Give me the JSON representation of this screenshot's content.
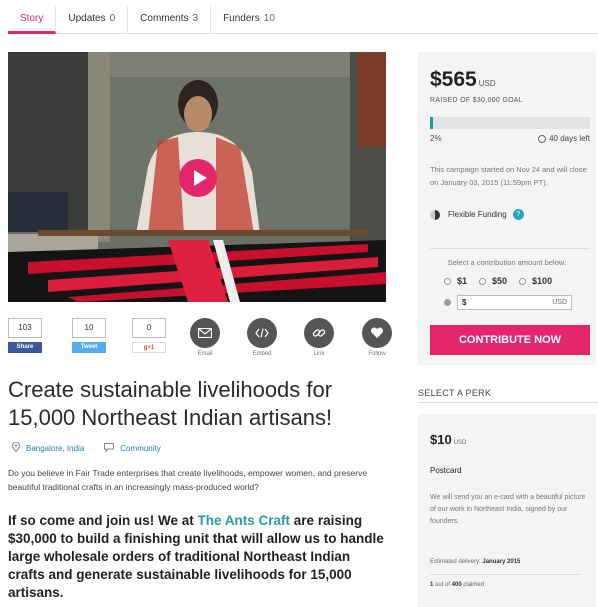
{
  "tabs": [
    {
      "label": "Story",
      "count": ""
    },
    {
      "label": "Updates",
      "count": "0"
    },
    {
      "label": "Comments",
      "count": "3"
    },
    {
      "label": "Funders",
      "count": "10"
    }
  ],
  "social": {
    "facebook": {
      "count": "103",
      "label": "Share"
    },
    "twitter": {
      "count": "10",
      "label": "Tweet"
    },
    "gplus": {
      "count": "0",
      "label": "g+1"
    },
    "actions": [
      {
        "label": "Email",
        "icon": "envelope-icon"
      },
      {
        "label": "Embed",
        "icon": "code-icon"
      },
      {
        "label": "Link",
        "icon": "link-icon"
      },
      {
        "label": "Follow",
        "icon": "heart-icon"
      }
    ]
  },
  "project": {
    "title": "Create sustainable livelihoods for 15,000 Northeast Indian artisans!",
    "location": "Bangalore, India",
    "category": "Community",
    "blurb": "Do you believe in Fair Trade enterprises that create livelihoods, empower women, and preserve beautiful traditional crafts in an increasingly mass-produced world?",
    "pitch_before": "If so come and join us! We at ",
    "pitch_link": "The Ants Craft",
    "pitch_after": " are raising $30,000 to build a finishing unit that will allow us to handle large wholesale orders of traditional Northeast Indian crafts and generate sustainable livelihoods for 15,000 artisans."
  },
  "funding": {
    "amount": "$565",
    "currency": "USD",
    "raised_of": "RAISED OF $30,000 GOAL",
    "percent": "2%",
    "progress": 0.02,
    "days_left": "40 days left",
    "started_text": "This campaign started on Nov 24 and will close on January 03, 2015 (11:59pm PT).",
    "funding_type": "Flexible Funding",
    "select_label": "Select a contribution amount below:",
    "options": [
      "$1",
      "$50",
      "$100"
    ],
    "custom_prefix": "$",
    "custom_currency": "USD",
    "contribute_label": "CONTRIBUTE NOW"
  },
  "perks": {
    "heading": "SELECT A PERK",
    "items": [
      {
        "amount": "$10",
        "currency": "USD",
        "title": "Postcard",
        "description": "We will send you an e-card with a beautiful picture of our work in Northeast India, signed by our founders.",
        "delivery_label": "Estimated delivery:",
        "delivery_value": "January 2015",
        "claimed_prefix": "1",
        "claimed_middle": " out of ",
        "claimed_total": "400",
        "claimed_suffix": " claimed"
      }
    ]
  },
  "colors": {
    "accent": "#e3256b",
    "progress": "#1a9c9c",
    "link": "#2a7fa8"
  }
}
